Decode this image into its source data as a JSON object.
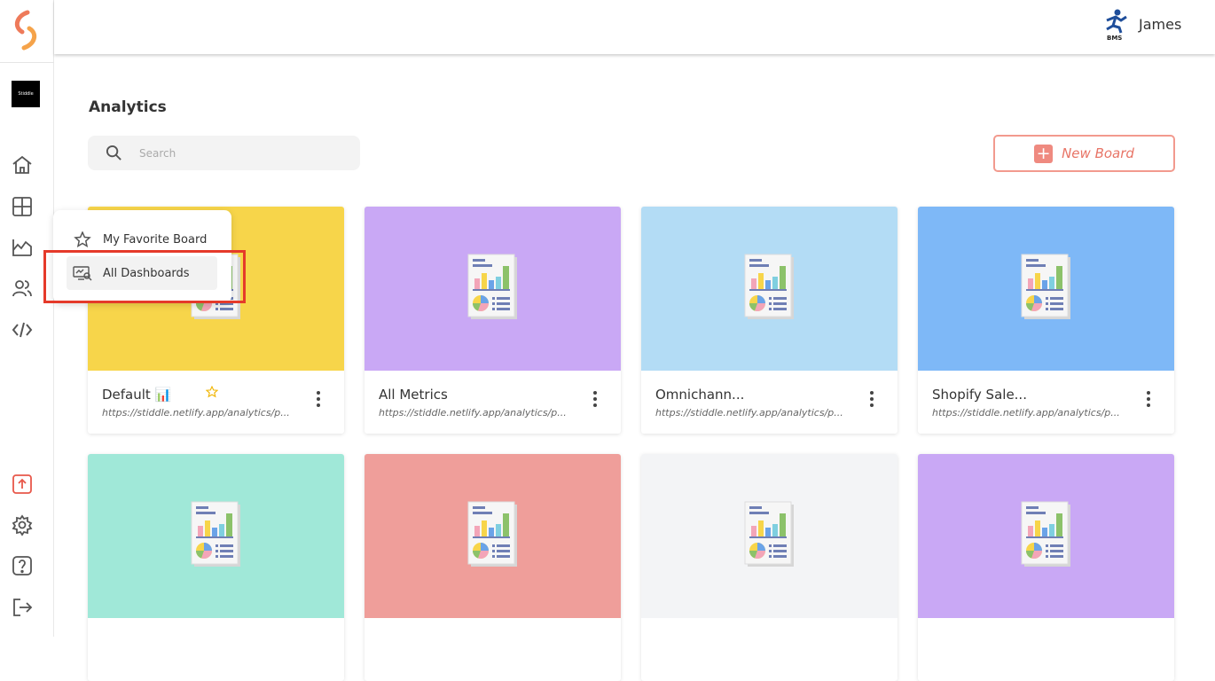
{
  "brand": {
    "logo_icon": "stiddle-logo-icon",
    "workspace_label": "Stiddle"
  },
  "sidebar": {
    "items": [
      {
        "name": "home-icon"
      },
      {
        "name": "dashboard-grid-icon"
      },
      {
        "name": "analytics-chart-icon"
      },
      {
        "name": "users-icon"
      },
      {
        "name": "code-icon"
      },
      {
        "name": "upload-icon"
      },
      {
        "name": "settings-gear-icon"
      },
      {
        "name": "help-icon"
      },
      {
        "name": "logout-icon"
      }
    ]
  },
  "header": {
    "user_name": "James",
    "user_logo_text": "BMS"
  },
  "page": {
    "title": "Analytics"
  },
  "search": {
    "placeholder": "Search"
  },
  "toolbar": {
    "new_board_label": "New Board"
  },
  "dropdown": {
    "items": [
      {
        "label": "My Favorite Board",
        "icon": "star-icon"
      },
      {
        "label": "All Dashboards",
        "icon": "dashboards-icon"
      }
    ]
  },
  "cards": [
    {
      "title": "Default 📊",
      "url": "https://stiddle.netlify.app/analytics/p...",
      "color": "#f7d54a",
      "favorite": true
    },
    {
      "title": "All Metrics",
      "url": "https://stiddle.netlify.app/analytics/p...",
      "color": "#c9a8f5"
    },
    {
      "title": "Omnichann...",
      "url": "https://stiddle.netlify.app/analytics/p...",
      "color": "#b3dcf5"
    },
    {
      "title": "Shopify Sale...",
      "url": "https://stiddle.netlify.app/analytics/p...",
      "color": "#7eb8f7"
    },
    {
      "title": "",
      "url": "",
      "color": "#a0e8d8"
    },
    {
      "title": "",
      "url": "",
      "color": "#ef9e9a"
    },
    {
      "title": "",
      "url": "",
      "color": "#f3f4f6"
    },
    {
      "title": "",
      "url": "",
      "color": "#c9a8f5"
    }
  ],
  "colors": {
    "accent": "#e87567",
    "highlight": "#e53a2a"
  }
}
